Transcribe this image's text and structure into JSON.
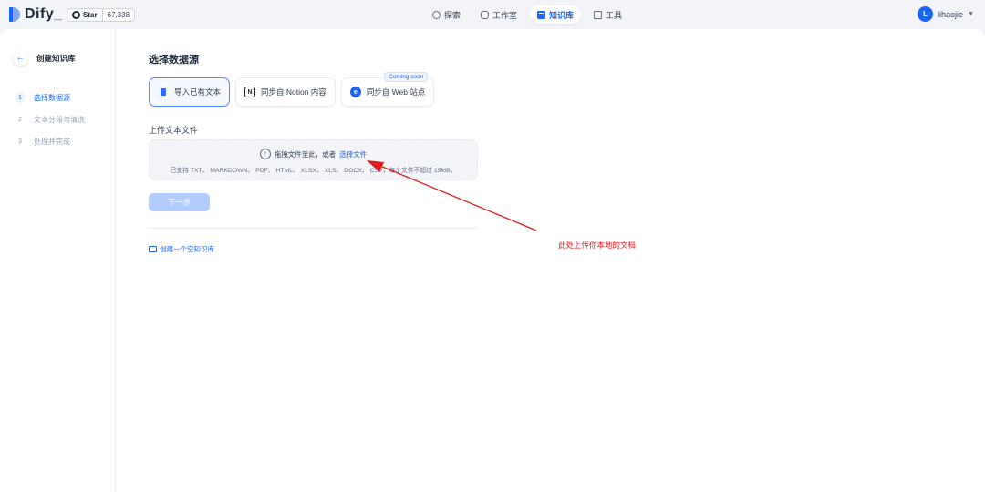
{
  "app": {
    "logo_text": "Dify",
    "github_star_label": "Star",
    "github_star_count": "67,338"
  },
  "nav": {
    "items": [
      {
        "label": "探索",
        "icon": "compass-icon"
      },
      {
        "label": "工作室",
        "icon": "studio-icon"
      },
      {
        "label": "知识库",
        "icon": "book-icon",
        "active": true
      },
      {
        "label": "工具",
        "icon": "toolbox-icon"
      }
    ]
  },
  "user": {
    "initial": "L",
    "name": "lihaojie"
  },
  "sidebar": {
    "back_title": "创建知识库",
    "steps": [
      {
        "num": "1",
        "label": "选择数据源",
        "active": true
      },
      {
        "num": "2",
        "label": "文本分段与清洗"
      },
      {
        "num": "3",
        "label": "处理并完成"
      }
    ]
  },
  "main": {
    "title": "选择数据源",
    "sources": [
      {
        "label": "导入已有文本",
        "icon": "file-icon"
      },
      {
        "label": "同步自 Notion 内容",
        "icon": "notion-icon"
      },
      {
        "label": "同步自 Web 站点",
        "icon": "web-icon",
        "badge": "Coming soon"
      }
    ],
    "upload_label": "上传文本文件",
    "dropzone": {
      "text": "拖拽文件至此，或者",
      "link": "选择文件",
      "hint": "已支持 TXT、 MARKDOWN、 PDF、 HTML、 XLSX、 XLS、 DOCX、 CSV，每个文件不超过 15MB。"
    },
    "next_button": "下一步",
    "create_empty": "创建一个空知识库"
  },
  "annotation": {
    "text": "此处上传你本地的文档",
    "color": "#e31d1d"
  }
}
